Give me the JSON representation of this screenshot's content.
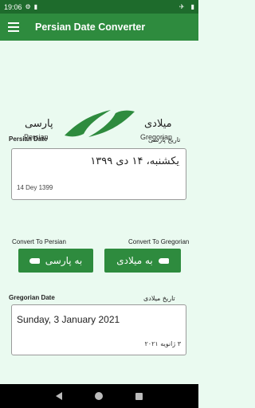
{
  "status_bar": {
    "time": "19:06"
  },
  "app_bar": {
    "title": "Persian Date Converter"
  },
  "logo": {
    "persian_label_fa": "پارسی",
    "persian_label_en": "Persian",
    "gregorian_label_fa": "میلادی",
    "gregorian_label_en": "Gregorian"
  },
  "persian_section": {
    "label_en": "Persian Date",
    "label_fa": "تاریخ پارسی",
    "main_text": "یکشنبه، ۱۴ دی ۱۳۹۹",
    "sub_text": "14 Dey 1399"
  },
  "buttons": {
    "convert_to_persian_label": "Convert To Persian",
    "convert_to_gregorian_label": "Convert To Gregorian",
    "to_persian_button": "به پارسی",
    "to_gregorian_button": "به میلادی"
  },
  "gregorian_section": {
    "label_en": "Gregorian Date",
    "label_fa": "تاریخ میلادی",
    "main_text": "Sunday, 3 January 2021",
    "sub_text": "۳ ژانویه ۲۰۲۱"
  },
  "colors": {
    "primary": "#2e8b3e",
    "status_bar": "#1e6b2c",
    "background": "#eafaf0"
  }
}
